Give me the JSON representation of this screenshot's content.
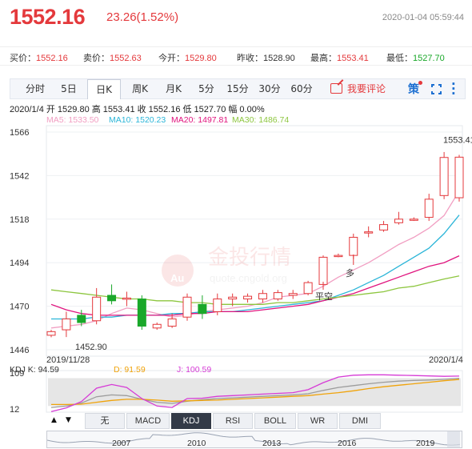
{
  "header": {
    "price": "1552.16",
    "change": "23.26(1.52%)",
    "datetime": "2020-01-04 05:59:44"
  },
  "quotes": [
    {
      "label": "买价：",
      "value": "1552.16",
      "color": "#e4393c"
    },
    {
      "label": "卖价：",
      "value": "1552.63",
      "color": "#e4393c"
    },
    {
      "label": "今开：",
      "value": "1529.80",
      "color": "#e4393c"
    },
    {
      "label": "昨收：",
      "value": "1528.90",
      "color": "#333333"
    },
    {
      "label": "最高：",
      "value": "1553.41",
      "color": "#e4393c"
    },
    {
      "label": "最低：",
      "value": "1527.70",
      "color": "#1aa82a"
    }
  ],
  "toolbar": {
    "tabs": [
      "分时",
      "5日",
      "日K",
      "周K",
      "月K",
      "5分",
      "15分",
      "30分",
      "60分"
    ],
    "active_tab": "日K",
    "comment_label": "我要评论",
    "strategy_label": "策"
  },
  "ohlc_line": "2020/1/4   开 1529.80   高 1553.41   收 1552.16   低 1527.70   幅 0.00%",
  "ma_labels": [
    {
      "text": "MA5: 1533.50",
      "color": "#f19ec2"
    },
    {
      "text": "MA10: 1520.23",
      "color": "#2bb5d8"
    },
    {
      "text": "MA20: 1497.81",
      "color": "#e0147e"
    },
    {
      "text": "MA30: 1486.74",
      "color": "#8dc63f"
    }
  ],
  "watermark": {
    "brand": "金投行情",
    "url": "quote.cngold.org",
    "logo": "Au"
  },
  "chart_data": {
    "type": "candlestick",
    "y_ticks": [
      "1566",
      "1542",
      "1518",
      "1494",
      "1470",
      "1446"
    ],
    "ylim": [
      1446,
      1566
    ],
    "x_start_label": "2019/11/28",
    "x_end_label": "2020/1/4",
    "max_label": "1553.41",
    "min_label": "1452.90",
    "annotations": [
      "多",
      "平空"
    ],
    "candles": [
      {
        "o": 1454.0,
        "c": 1456.0,
        "h": 1457.0,
        "l": 1452.9
      },
      {
        "o": 1457.0,
        "c": 1463.0,
        "h": 1467.0,
        "l": 1453.0
      },
      {
        "o": 1465.0,
        "c": 1461.0,
        "h": 1468.0,
        "l": 1459.0
      },
      {
        "o": 1462.0,
        "c": 1475.0,
        "h": 1480.0,
        "l": 1460.0
      },
      {
        "o": 1476.0,
        "c": 1473.0,
        "h": 1482.0,
        "l": 1471.0
      },
      {
        "o": 1474.0,
        "c": 1474.5,
        "h": 1478.0,
        "l": 1470.0
      },
      {
        "o": 1474.0,
        "c": 1459.0,
        "h": 1476.0,
        "l": 1457.0
      },
      {
        "o": 1458.0,
        "c": 1460.0,
        "h": 1461.0,
        "l": 1457.0
      },
      {
        "o": 1459.0,
        "c": 1463.0,
        "h": 1466.0,
        "l": 1458.0
      },
      {
        "o": 1464.0,
        "c": 1475.0,
        "h": 1477.0,
        "l": 1462.0
      },
      {
        "o": 1471.0,
        "c": 1466.0,
        "h": 1476.0,
        "l": 1463.0
      },
      {
        "o": 1467.0,
        "c": 1474.0,
        "h": 1477.0,
        "l": 1465.0
      },
      {
        "o": 1474.0,
        "c": 1475.0,
        "h": 1477.0,
        "l": 1470.0
      },
      {
        "o": 1474.0,
        "c": 1475.5,
        "h": 1477.0,
        "l": 1472.0
      },
      {
        "o": 1474.0,
        "c": 1477.0,
        "h": 1479.0,
        "l": 1472.0
      },
      {
        "o": 1474.0,
        "c": 1477.5,
        "h": 1479.0,
        "l": 1473.0
      },
      {
        "o": 1476.0,
        "c": 1477.0,
        "h": 1479.0,
        "l": 1474.0
      },
      {
        "o": 1477.0,
        "c": 1483.0,
        "h": 1484.0,
        "l": 1476.0
      },
      {
        "o": 1482.0,
        "c": 1497.0,
        "h": 1498.0,
        "l": 1481.0
      },
      {
        "o": 1498.0,
        "c": 1498.0,
        "h": 1499.0,
        "l": 1497.0
      },
      {
        "o": 1498.0,
        "c": 1508.0,
        "h": 1510.0,
        "l": 1496.0
      },
      {
        "o": 1511.0,
        "c": 1511.0,
        "h": 1514.0,
        "l": 1508.0
      },
      {
        "o": 1512.0,
        "c": 1515.0,
        "h": 1517.0,
        "l": 1511.0
      },
      {
        "o": 1516.0,
        "c": 1518.0,
        "h": 1522.0,
        "l": 1515.0
      },
      {
        "o": 1518.0,
        "c": 1518.0,
        "h": 1519.0,
        "l": 1517.0
      },
      {
        "o": 1519.0,
        "c": 1529.0,
        "h": 1532.0,
        "l": 1517.0
      },
      {
        "o": 1531.0,
        "c": 1552.0,
        "h": 1555.0,
        "l": 1529.0
      },
      {
        "o": 1529.8,
        "c": 1552.16,
        "h": 1553.41,
        "l": 1527.7
      }
    ],
    "series": [
      {
        "name": "MA5",
        "values": [
          1458,
          1459,
          1460,
          1462,
          1466,
          1469,
          1468,
          1466,
          1464,
          1465,
          1467,
          1468,
          1469,
          1470,
          1472,
          1475,
          1476,
          1477,
          1481,
          1486,
          1490,
          1494,
          1499,
          1504,
          1508,
          1513,
          1520,
          1533.5
        ]
      },
      {
        "name": "MA10",
        "values": [
          1463,
          1463,
          1463,
          1464,
          1464,
          1465,
          1465,
          1465,
          1466,
          1466,
          1467,
          1467,
          1467,
          1468,
          1469,
          1470,
          1471,
          1472,
          1473,
          1476,
          1479,
          1483,
          1487,
          1492,
          1497,
          1502,
          1510,
          1520.23
        ]
      },
      {
        "name": "MA20",
        "values": [
          1471,
          1468,
          1466,
          1465,
          1465,
          1465,
          1465,
          1465,
          1465,
          1466,
          1466,
          1467,
          1467,
          1467,
          1468,
          1469,
          1470,
          1471,
          1473,
          1475,
          1477,
          1480,
          1483,
          1486,
          1489,
          1492,
          1494,
          1497.81
        ]
      },
      {
        "name": "MA30",
        "values": [
          1479,
          1478,
          1477,
          1476,
          1475,
          1474,
          1474,
          1473,
          1473,
          1472,
          1472,
          1471,
          1471,
          1471,
          1471,
          1472,
          1472,
          1473,
          1474,
          1475,
          1476,
          1477,
          1478,
          1480,
          1481,
          1483,
          1485,
          1486.74
        ]
      }
    ]
  },
  "kdj": {
    "k_label": "KDJ  K: 94.59",
    "d_label": "D: 91.59",
    "j_label": "J: 100.59",
    "y_ticks": [
      "109",
      "12"
    ],
    "colors": {
      "k": "#9c9c9c",
      "d": "#f0a30a",
      "j": "#d63bd6"
    },
    "k": [
      16,
      20,
      28,
      45,
      50,
      48,
      38,
      30,
      27,
      33,
      37,
      40,
      42,
      44,
      46,
      48,
      50,
      53,
      62,
      70,
      75,
      80,
      84,
      87,
      89,
      90,
      92,
      94.59
    ],
    "d": [
      24,
      24,
      25,
      30,
      35,
      38,
      38,
      36,
      33,
      34,
      35,
      36,
      38,
      40,
      42,
      44,
      46,
      48,
      52,
      56,
      61,
      67,
      72,
      76,
      80,
      84,
      88,
      91.59
    ],
    "j": [
      5,
      15,
      32,
      68,
      78,
      70,
      40,
      20,
      16,
      40,
      41,
      46,
      48,
      50,
      52,
      54,
      56,
      64,
      83,
      98,
      103,
      104,
      104,
      103,
      102,
      101,
      100,
      100.59
    ]
  },
  "indicator_tabs": [
    "无",
    "MACD",
    "KDJ",
    "RSI",
    "BOLL",
    "WR",
    "DMI"
  ],
  "active_indicator": "KDJ",
  "overview_years": [
    "2007",
    "2010",
    "2013",
    "2016",
    "2019"
  ]
}
